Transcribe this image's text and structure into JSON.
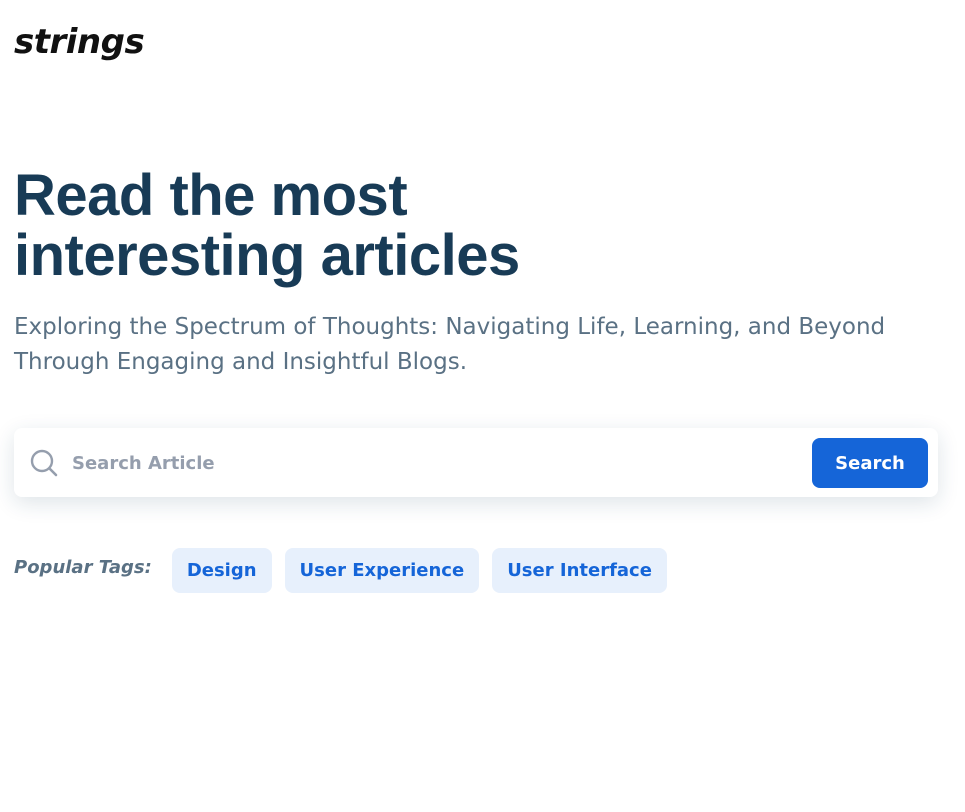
{
  "header": {
    "logo_text": "strings"
  },
  "hero": {
    "title_line1": "Read the most",
    "title_line2": "interesting articles",
    "subtitle": "Exploring the Spectrum of Thoughts: Navigating Life, Learning, and Beyond Through Engaging and Insightful Blogs."
  },
  "search": {
    "icon": "search-icon",
    "placeholder": "Search Article",
    "value": "",
    "button_label": "Search"
  },
  "tags": {
    "label": "Popular Tags:",
    "items": [
      "Design",
      "User Experience",
      "User Interface"
    ]
  },
  "colors": {
    "heading": "#183b56",
    "body_text": "#5a7184",
    "accent": "#1565d8",
    "tag_background": "#e7f0fc",
    "placeholder": "#959ead"
  }
}
